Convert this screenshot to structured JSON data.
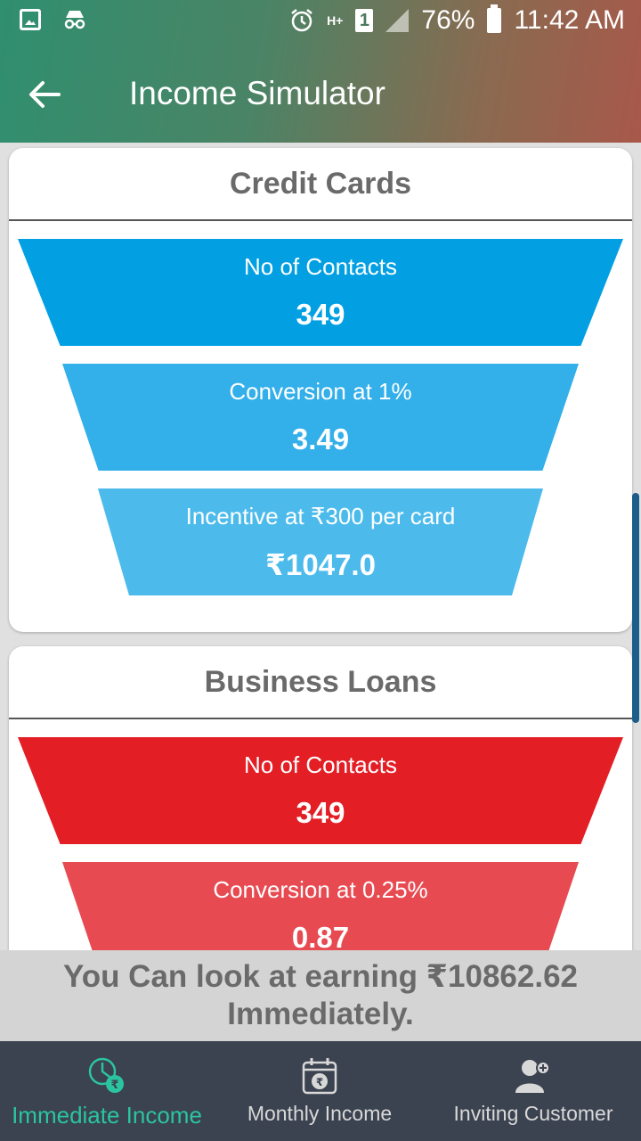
{
  "status_bar": {
    "battery": "76%",
    "time": "11:42 AM",
    "network": "H+",
    "sim": "1"
  },
  "header": {
    "title": "Income Simulator"
  },
  "cards": [
    {
      "title": "Credit Cards",
      "stages": [
        {
          "label": "No of Contacts",
          "value": "349",
          "color": "#02a0e3"
        },
        {
          "label": "Conversion at 1%",
          "value": "3.49",
          "color": "#33afea"
        },
        {
          "label": "Incentive at ₹300 per card",
          "value": "₹1047.0",
          "color": "#4cbbec"
        }
      ]
    },
    {
      "title": "Business Loans",
      "stages": [
        {
          "label": "No of Contacts",
          "value": "349",
          "color": "#e31e25"
        },
        {
          "label": "Conversion at 0.25%",
          "value": "0.87",
          "color": "#e84a52"
        }
      ]
    }
  ],
  "earnings": {
    "line1": "You Can look at earning ₹10862.62",
    "line2": "Immediately."
  },
  "bottom_nav": [
    {
      "label": "Immediate Income",
      "icon": "immediate-income-icon",
      "active": true
    },
    {
      "label": "Monthly Income",
      "icon": "calendar-rupee-icon",
      "active": false
    },
    {
      "label": "Inviting Customer",
      "icon": "add-user-icon",
      "active": false
    }
  ],
  "colors": {
    "accent": "#2bc4a2",
    "nav_bg": "#3b4250"
  }
}
